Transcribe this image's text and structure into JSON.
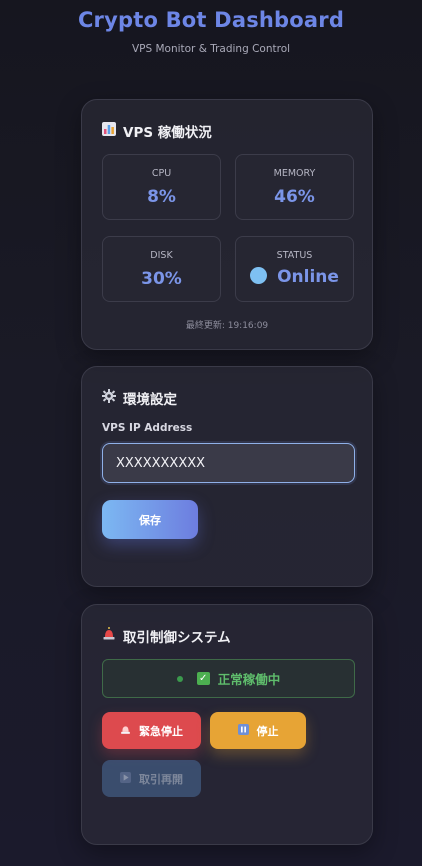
{
  "header": {
    "title": "Crypto Bot Dashboard",
    "subtitle": "VPS Monitor & Trading Control"
  },
  "vps_status": {
    "title": "VPS 稼働状況",
    "stats": [
      {
        "label": "CPU",
        "value": "8%"
      },
      {
        "label": "MEMORY",
        "value": "46%"
      },
      {
        "label": "DISK",
        "value": "30%"
      },
      {
        "label": "STATUS",
        "value": "Online"
      }
    ],
    "last_updated": "最終更新: 19:16:09",
    "icon": "bar-chart-icon"
  },
  "settings": {
    "title": "環境設定",
    "icon": "gear-icon",
    "ip_label": "VPS IP Address",
    "ip_value": "XXXXXXXXXX",
    "save_label": "保存"
  },
  "trading": {
    "title": "取引制御システム",
    "icon": "siren-icon",
    "status_text": "正常稼働中",
    "emergency_label": "緊急停止",
    "stop_label": "停止",
    "resume_label": "取引再開"
  },
  "colors": {
    "accent": "#6d86e6",
    "online": "#7ec0f2",
    "ok": "#5fbd6c",
    "danger": "#dd4a4e",
    "warning": "#e7a435"
  }
}
